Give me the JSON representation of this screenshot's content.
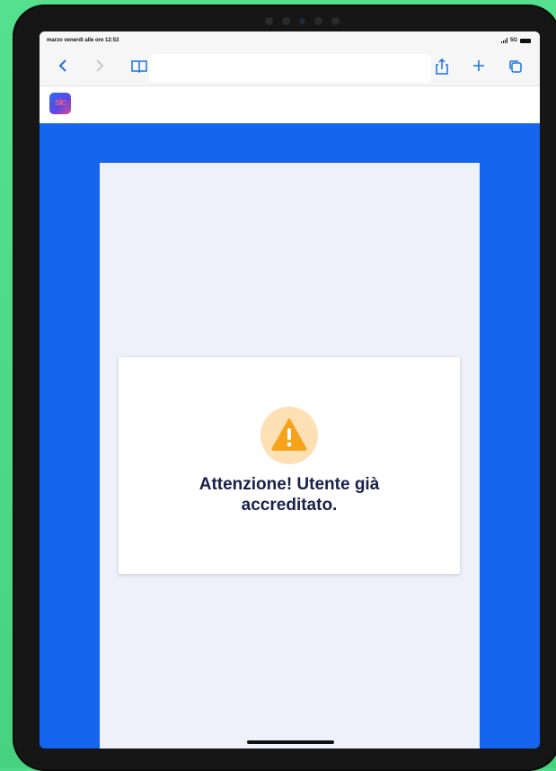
{
  "status_bar": {
    "time_text": "marzo venerdì alle ore 12:53",
    "network": "5G"
  },
  "toolbar": {
    "back_icon": "chevron-left-icon",
    "forward_icon": "chevron-right-icon",
    "bookmarks_icon": "book-icon",
    "share_icon": "share-icon",
    "new_tab_icon": "plus-icon",
    "tabs_icon": "tabs-icon",
    "url_value": ""
  },
  "site": {
    "logo_text": "sic"
  },
  "alert": {
    "icon": "warning-icon",
    "line1": "Attenzione! Utente già",
    "line2": "accreditato."
  },
  "colors": {
    "page_background": "#1565ee",
    "panel": "#eef0fa",
    "warning": "#f7a21b",
    "warning_bg": "#fde0b4",
    "text": "#18204a"
  }
}
